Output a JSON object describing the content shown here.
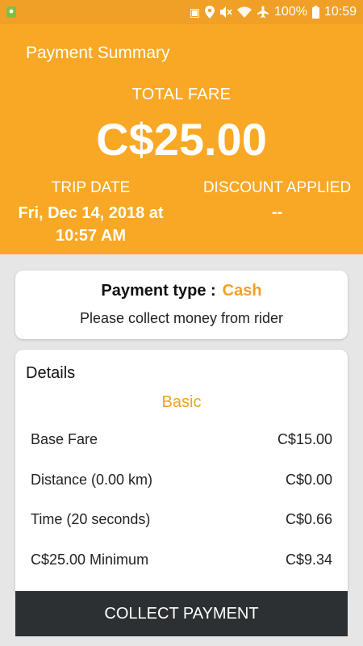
{
  "status_bar": {
    "battery": "100%",
    "time": "10:59",
    "icons": [
      "location-app-icon",
      "sim-icon",
      "location-icon",
      "mute-icon",
      "wifi-icon",
      "airplane-icon",
      "battery-icon"
    ]
  },
  "header": {
    "title": "Payment Summary",
    "total_fare_label": "TOTAL FARE",
    "total_fare_value": "C$25.00",
    "trip_date_label": "TRIP DATE",
    "trip_date_line1": "Fri, Dec 14, 2018 at",
    "trip_date_line2": "10:57 AM",
    "discount_label": "DISCOUNT APPLIED",
    "discount_value": "--"
  },
  "payment": {
    "type_label": "Payment type :",
    "type_value": "Cash",
    "note": "Please collect money from rider"
  },
  "details": {
    "title": "Details",
    "plan": "Basic",
    "rows": [
      {
        "label": "Base Fare",
        "value": "C$15.00"
      },
      {
        "label": "Distance (0.00 km)",
        "value": "C$0.00"
      },
      {
        "label": "Time (20 seconds)",
        "value": "C$0.66"
      },
      {
        "label": "C$25.00 Minimum",
        "value": "C$9.34"
      }
    ]
  },
  "action": {
    "collect_label": "COLLECT PAYMENT"
  },
  "colors": {
    "header_bg": "#f9a825",
    "status_bg": "#f0a026",
    "accent": "#f0a026",
    "button_bg": "#2d3033"
  }
}
